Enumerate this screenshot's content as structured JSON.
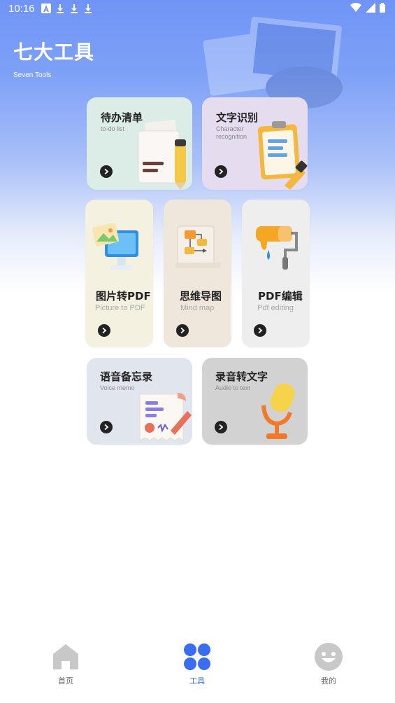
{
  "status_bar": {
    "time": "10:16",
    "notifications": [
      "a-icon",
      "download-icon",
      "download-icon",
      "download-icon"
    ],
    "system_icons": [
      "wifi-icon",
      "signal-icon",
      "battery-icon"
    ]
  },
  "header": {
    "title": "七大工具",
    "subtitle": "Seven Tools"
  },
  "tools": [
    {
      "key": "todo",
      "title": "待办清单",
      "subtitle": "to-do list",
      "bg": "#dcece6",
      "icon": "notepad-pencil-icon"
    },
    {
      "key": "ocr",
      "title": "文字识别",
      "subtitle": "Character recognition",
      "subtitle_line1": "Character",
      "subtitle_line2": "recognition",
      "bg": "#e6dcf0",
      "icon": "clipboard-icon"
    },
    {
      "key": "img2pdf",
      "title": "图片转PDF",
      "subtitle": "Picture to PDF",
      "bg": "#f5f1e1",
      "icon": "monitor-image-icon"
    },
    {
      "key": "mindmap",
      "title": "思维导图",
      "subtitle": "Mind map",
      "bg": "#efe6dc",
      "icon": "flowchart-icon"
    },
    {
      "key": "pdfedit",
      "title": "PDF编辑",
      "subtitle": "Pdf editing",
      "bg": "#eeeeee",
      "icon": "paint-roller-icon"
    },
    {
      "key": "voicememo",
      "title": "语音备忘录",
      "subtitle": "Voice memo",
      "bg": "#e1e6ee",
      "icon": "memo-receipt-icon"
    },
    {
      "key": "audio2text",
      "title": "录音转文字",
      "subtitle": "Audio to text",
      "bg": "#d2d2d2",
      "icon": "microphone-icon"
    }
  ],
  "bottom_nav": {
    "items": [
      {
        "label": "首页",
        "icon": "home-icon",
        "active": false
      },
      {
        "label": "工具",
        "icon": "grid-icon",
        "active": true
      },
      {
        "label": "我的",
        "icon": "smiley-icon",
        "active": false
      }
    ]
  },
  "colors": {
    "accent": "#3b6df0",
    "hero_top": "#6f94f6",
    "nav_inactive": "#c8c8c8"
  }
}
